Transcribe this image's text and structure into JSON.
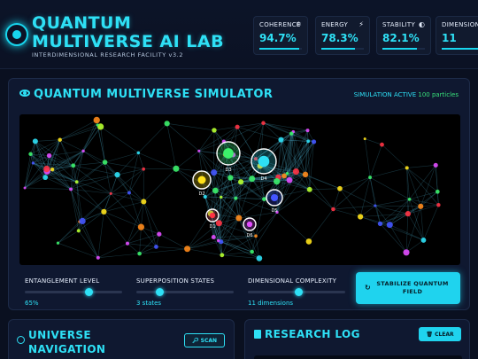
{
  "header": {
    "title": "QUANTUM MULTIVERSE AI LAB",
    "subtitle": "INTERDIMENSIONAL RESEARCH FACILITY v3.2",
    "stats": [
      {
        "label": "COHERENCE",
        "icon": "atom-icon",
        "value": "94.7%",
        "level": 0.947
      },
      {
        "label": "ENERGY",
        "icon": "bolt-icon",
        "value": "78.3%",
        "level": 0.783
      },
      {
        "label": "STABILITY",
        "icon": "half-circle-icon",
        "value": "82.1%",
        "level": 0.821
      },
      {
        "label": "DIMENSIONS",
        "icon": "cube-icon",
        "value": "11",
        "level": 1.0
      }
    ]
  },
  "simulator": {
    "title": "QUANTUM MULTIVERSE SIMULATOR",
    "status_label": "SIMULATION ACTIVE",
    "status_count": "100 particles",
    "universes": [
      {
        "label": "D3",
        "color": "#3cf06a"
      },
      {
        "label": "D4",
        "color": "#2ee0f5"
      },
      {
        "label": "D2",
        "color": "#ffe21a"
      },
      {
        "label": "D5",
        "color": "#4455ff"
      },
      {
        "label": "D1",
        "color": "#ff3344"
      },
      {
        "label": "D6",
        "color": "#e24cff"
      }
    ],
    "controls": [
      {
        "label": "ENTANGLEMENT LEVEL",
        "value": "65%",
        "level": 0.65
      },
      {
        "label": "SUPERPOSITION STATES",
        "value": "3 states",
        "level": 0.24
      },
      {
        "label": "DIMENSIONAL COMPLEXITY",
        "value": "11 dimensions",
        "level": 0.52
      }
    ],
    "stabilize_label": "STABILIZE QUANTUM FIELD"
  },
  "navigation": {
    "title": "UNIVERSE NAVIGATION",
    "scan_label": "SCAN"
  },
  "log": {
    "title": "RESEARCH LOG",
    "clear_label": "CLEAR"
  },
  "colors": {
    "accent": "#2ee0f5",
    "background": "#0a1020",
    "panel": "#0f1830",
    "status_green": "#38e07a"
  }
}
